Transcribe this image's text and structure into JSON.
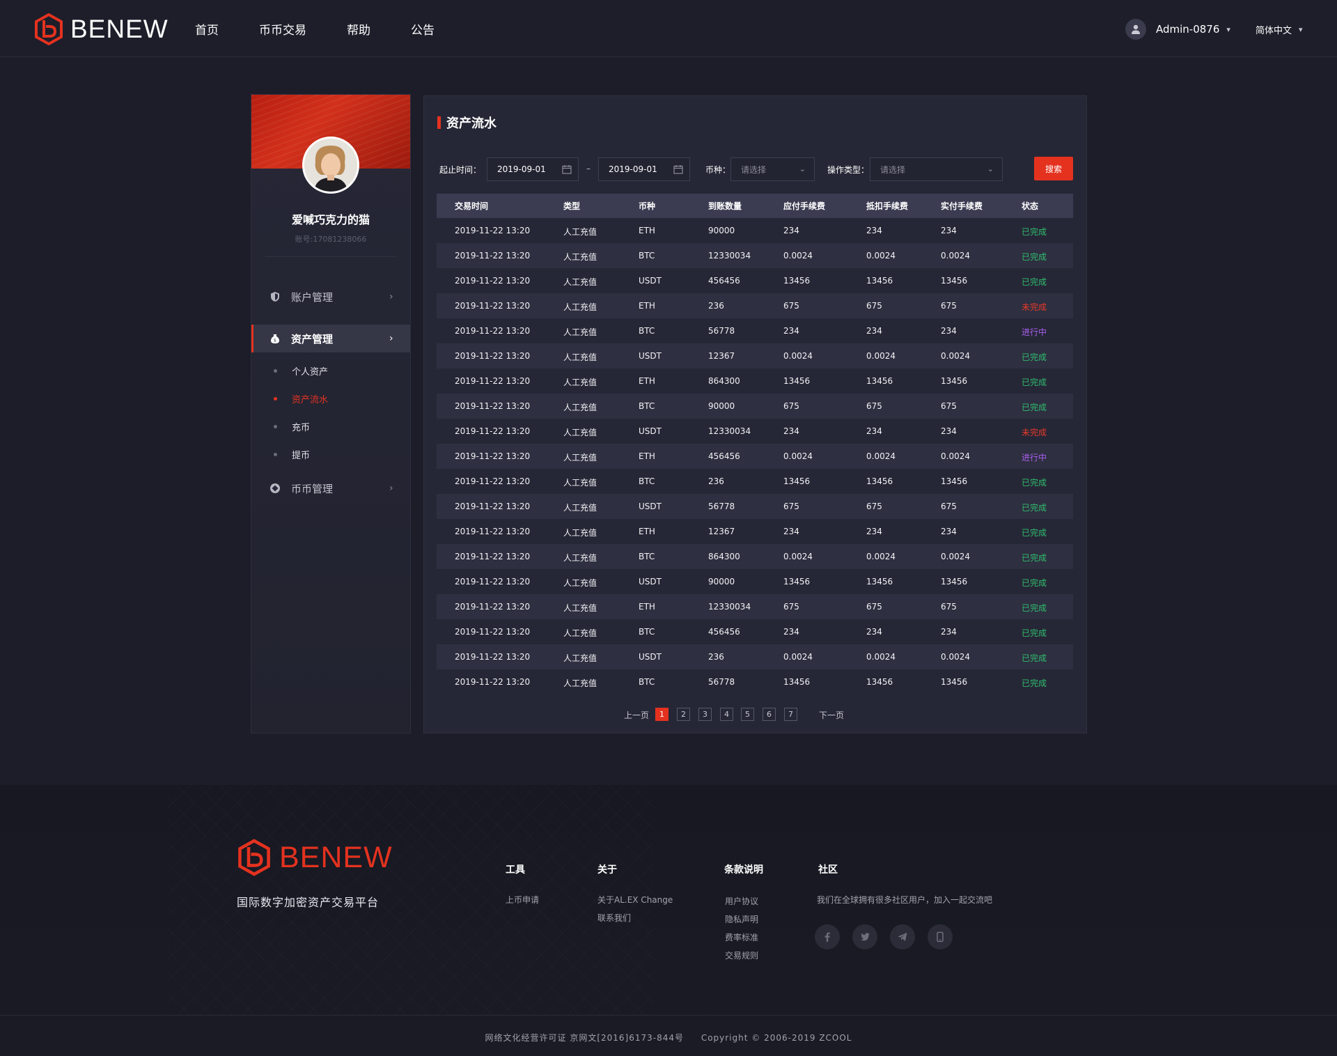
{
  "header": {
    "brand": "BENEW",
    "nav": [
      "首页",
      "币币交易",
      "帮助",
      "公告"
    ],
    "user_name": "Admin-0876",
    "language": "简体中文"
  },
  "sidebar": {
    "user_name": "爱喊巧克力的猫",
    "account": "账号:17081238066",
    "menu": {
      "account": "账户管理",
      "assets": "资产管理",
      "coins": "币币管理"
    },
    "sub_items": [
      "个人资产",
      "资产流水",
      "充币",
      "提币"
    ],
    "active_sub": "资产流水"
  },
  "panel": {
    "title": "资产流水",
    "filters": {
      "range_label": "起止时间：",
      "start_date": "2019-09-01",
      "end_date": "2019-09-01",
      "dash": "–",
      "coin_label": "币种：",
      "coin_placeholder": "请选择",
      "op_label": "操作类型：",
      "op_placeholder": "请选择",
      "search_button": "搜索"
    },
    "columns": [
      "交易时间",
      "类型",
      "币种",
      "到账数量",
      "应付手续费",
      "抵扣手续费",
      "实付手续费",
      "状态"
    ],
    "rows": [
      [
        "2019-11-22 13:20",
        "人工充值",
        "ETH",
        "90000",
        "234",
        "234",
        "234",
        "已完成"
      ],
      [
        "2019-11-22 13:20",
        "人工充值",
        "BTC",
        "12330034",
        "0.0024",
        "0.0024",
        "0.0024",
        "已完成"
      ],
      [
        "2019-11-22 13:20",
        "人工充值",
        "USDT",
        "456456",
        "13456",
        "13456",
        "13456",
        "已完成"
      ],
      [
        "2019-11-22 13:20",
        "人工充值",
        "ETH",
        "236",
        "675",
        "675",
        "675",
        "未完成"
      ],
      [
        "2019-11-22 13:20",
        "人工充值",
        "BTC",
        "56778",
        "234",
        "234",
        "234",
        "进行中"
      ],
      [
        "2019-11-22 13:20",
        "人工充值",
        "USDT",
        "12367",
        "0.0024",
        "0.0024",
        "0.0024",
        "已完成"
      ],
      [
        "2019-11-22 13:20",
        "人工充值",
        "ETH",
        "864300",
        "13456",
        "13456",
        "13456",
        "已完成"
      ],
      [
        "2019-11-22 13:20",
        "人工充值",
        "BTC",
        "90000",
        "675",
        "675",
        "675",
        "已完成"
      ],
      [
        "2019-11-22 13:20",
        "人工充值",
        "USDT",
        "12330034",
        "234",
        "234",
        "234",
        "未完成"
      ],
      [
        "2019-11-22 13:20",
        "人工充值",
        "ETH",
        "456456",
        "0.0024",
        "0.0024",
        "0.0024",
        "进行中"
      ],
      [
        "2019-11-22 13:20",
        "人工充值",
        "BTC",
        "236",
        "13456",
        "13456",
        "13456",
        "已完成"
      ],
      [
        "2019-11-22 13:20",
        "人工充值",
        "USDT",
        "56778",
        "675",
        "675",
        "675",
        "已完成"
      ],
      [
        "2019-11-22 13:20",
        "人工充值",
        "ETH",
        "12367",
        "234",
        "234",
        "234",
        "已完成"
      ],
      [
        "2019-11-22 13:20",
        "人工充值",
        "BTC",
        "864300",
        "0.0024",
        "0.0024",
        "0.0024",
        "已完成"
      ],
      [
        "2019-11-22 13:20",
        "人工充值",
        "USDT",
        "90000",
        "13456",
        "13456",
        "13456",
        "已完成"
      ],
      [
        "2019-11-22 13:20",
        "人工充值",
        "ETH",
        "12330034",
        "675",
        "675",
        "675",
        "已完成"
      ],
      [
        "2019-11-22 13:20",
        "人工充值",
        "BTC",
        "456456",
        "234",
        "234",
        "234",
        "已完成"
      ],
      [
        "2019-11-22 13:20",
        "人工充值",
        "USDT",
        "236",
        "0.0024",
        "0.0024",
        "0.0024",
        "已完成"
      ],
      [
        "2019-11-22 13:20",
        "人工充值",
        "BTC",
        "56778",
        "13456",
        "13456",
        "13456",
        "已完成"
      ]
    ],
    "status_colors": {
      "已完成": "#2fbf6e",
      "未完成": "#e8392a",
      "进行中": "#a85ff0"
    },
    "pagination": {
      "prev": "上一页",
      "pages": [
        "1",
        "2",
        "3",
        "4",
        "5",
        "6",
        "7"
      ],
      "current": "1",
      "next": "下一页"
    }
  },
  "footer": {
    "brand": "BENEW",
    "slogan": "国际数字加密资产交易平台",
    "columns": [
      {
        "title": "工具",
        "links": [
          "上币申请"
        ]
      },
      {
        "title": "关于",
        "links": [
          "关于AL.EX Change",
          "联系我们"
        ]
      },
      {
        "title": "条款说明",
        "links": [
          "用户协议",
          "隐私声明",
          "费率标准",
          "交易规则"
        ]
      },
      {
        "title": "社区",
        "links": []
      }
    ],
    "community_text": "我们在全球拥有很多社区用户，加入一起交流吧",
    "social_icons": [
      "facebook-icon",
      "twitter-icon",
      "telegram-icon",
      "mobile-icon"
    ],
    "license": "网络文化经营许可证 京网文[2016]6173-844号",
    "copyright": "Copyright © 2006-2019 ZCOOL"
  },
  "colors": {
    "accent": "#e4321f",
    "background": "#1c1d29",
    "panel": "#262736"
  }
}
